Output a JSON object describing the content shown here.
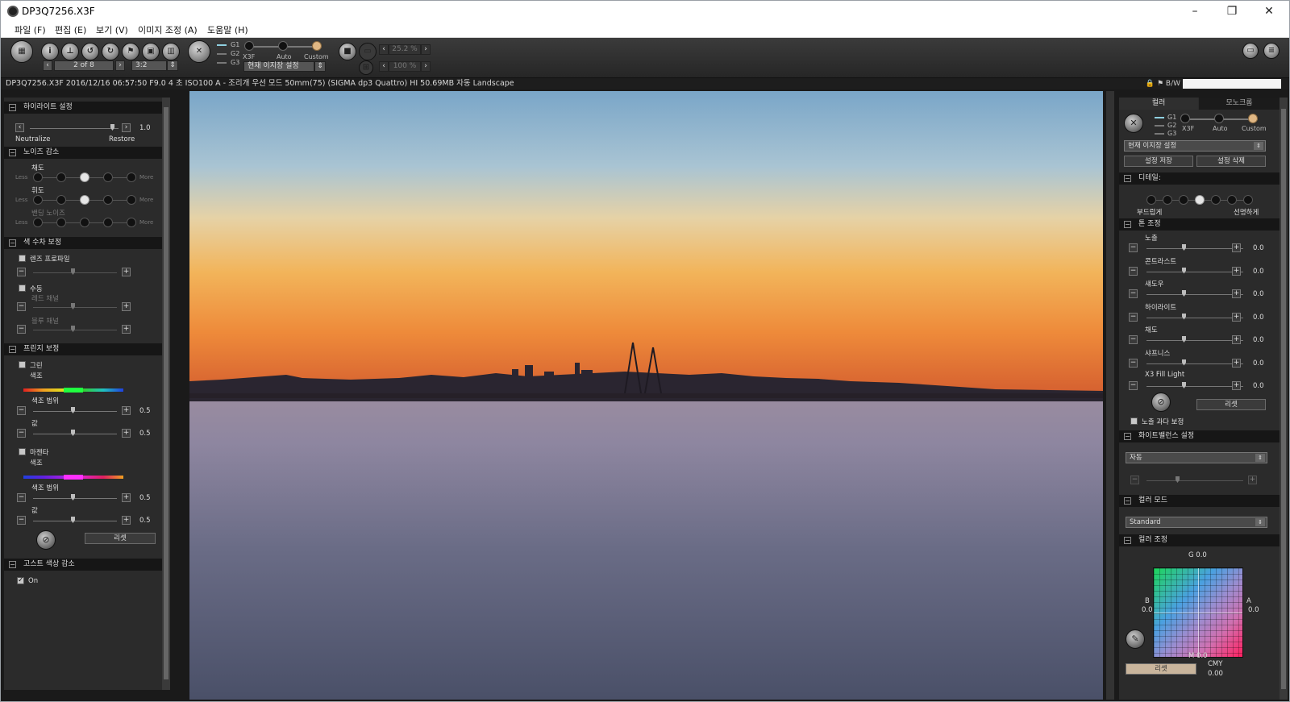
{
  "window": {
    "title": "DP3Q7256.X3F",
    "controls": [
      "–",
      "❐",
      "✕"
    ]
  },
  "menu": [
    "파일 (F)",
    "편집 (E)",
    "보기 (V)",
    "이미지 조정 (A)",
    "도움말 (H)"
  ],
  "toolbar": {
    "page": "2 of 8",
    "ratio": "3:2",
    "gl": [
      "G1",
      "G2",
      "G3"
    ],
    "modes": [
      "X3F",
      "Auto",
      "Custom"
    ],
    "preset": "현재 이지장 설정",
    "zoom1": "25.2 %",
    "zoom2": "100 %"
  },
  "infobar": {
    "text": "DP3Q7256.X3F 2016/12/16 06:57:50 F9.0 4 초 ISO100 A - 조리개 우선 모드 50mm(75) (SIGMA dp3 Quattro) HI 50.69MB 자동 Landscape",
    "bw": "B/W"
  },
  "left": {
    "highlight": {
      "title": "하이라이트 설정",
      "neutralize": "Neutralize",
      "restore": "Restore",
      "value": "1.0"
    },
    "noise": {
      "title": "노이즈 감소",
      "chroma": "채도",
      "luma": "휘도",
      "banding": "밴딩 노이즈",
      "less": "Less",
      "more": "More"
    },
    "aberration": {
      "title": "색 수차 보정",
      "lens_profile": "렌즈 프로파일",
      "manual": "수동",
      "red": "레드 채널",
      "blue": "블루 채널"
    },
    "fringe": {
      "title": "프린지 보정",
      "green": "그린",
      "magenta": "마젠타",
      "hue": "색조",
      "hue_range": "색조 범위",
      "amount": "값",
      "v1": "0.5",
      "v2": "0.5",
      "v3": "0.5",
      "v4": "0.5",
      "reset": "리셋"
    },
    "ghost": {
      "title": "고스트 색상 감소",
      "on": "On"
    }
  },
  "right": {
    "tabs": [
      "컬러",
      "모노크롬"
    ],
    "gl": [
      "G1",
      "G2",
      "G3"
    ],
    "modes": [
      "X3F",
      "Auto",
      "Custom"
    ],
    "preset": "현재 이지장 설정",
    "save": "설정 저장",
    "delete": "설정 삭제",
    "detail": {
      "title": "디테일:",
      "soft": "부드럽게",
      "sharp": "선명하게"
    },
    "tone": {
      "title": "톤 조정",
      "rows": [
        {
          "label": "노출",
          "value": "0.0"
        },
        {
          "label": "콘트라스트",
          "value": "0.0"
        },
        {
          "label": "섀도우",
          "value": "0.0"
        },
        {
          "label": "하이라이트",
          "value": "0.0"
        },
        {
          "label": "채도",
          "value": "0.0"
        },
        {
          "label": "샤프니스",
          "value": "0.0"
        },
        {
          "label": "X3 Fill Light",
          "value": "0.0"
        }
      ],
      "reset": "리셋",
      "overexposure": "노출 과다 보정"
    },
    "wb": {
      "title": "화이트밸런스 설정",
      "value": "자동"
    },
    "colormode": {
      "title": "컬러 모드",
      "value": "Standard"
    },
    "coloradj": {
      "title": "컬러 조정",
      "g": "G 0.0",
      "m": "M 0.0",
      "b": "B",
      "bval": "0.0",
      "a": "A",
      "aval": "0.0",
      "cmy": "CMY",
      "cmyval": "0.00",
      "reset": "리셋"
    }
  },
  "colors": {
    "accent_gold": "#e0b784",
    "panel_bg": "#2b2b2b"
  }
}
